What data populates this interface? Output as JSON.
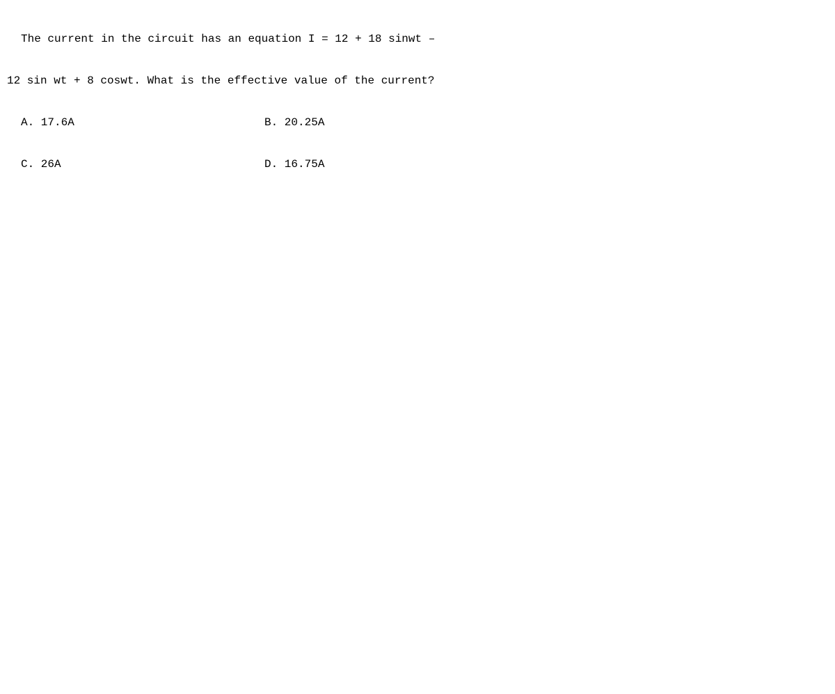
{
  "question": {
    "line1": "The current in the circuit has an equation I = 12 + 18 sinwt –",
    "line2": "12 sin wt + 8 coswt. What is the effective value of the current?"
  },
  "options": {
    "a": "A. 17.6A",
    "b": "B. 20.25A",
    "c": "C. 26A",
    "d": "D. 16.75A"
  }
}
